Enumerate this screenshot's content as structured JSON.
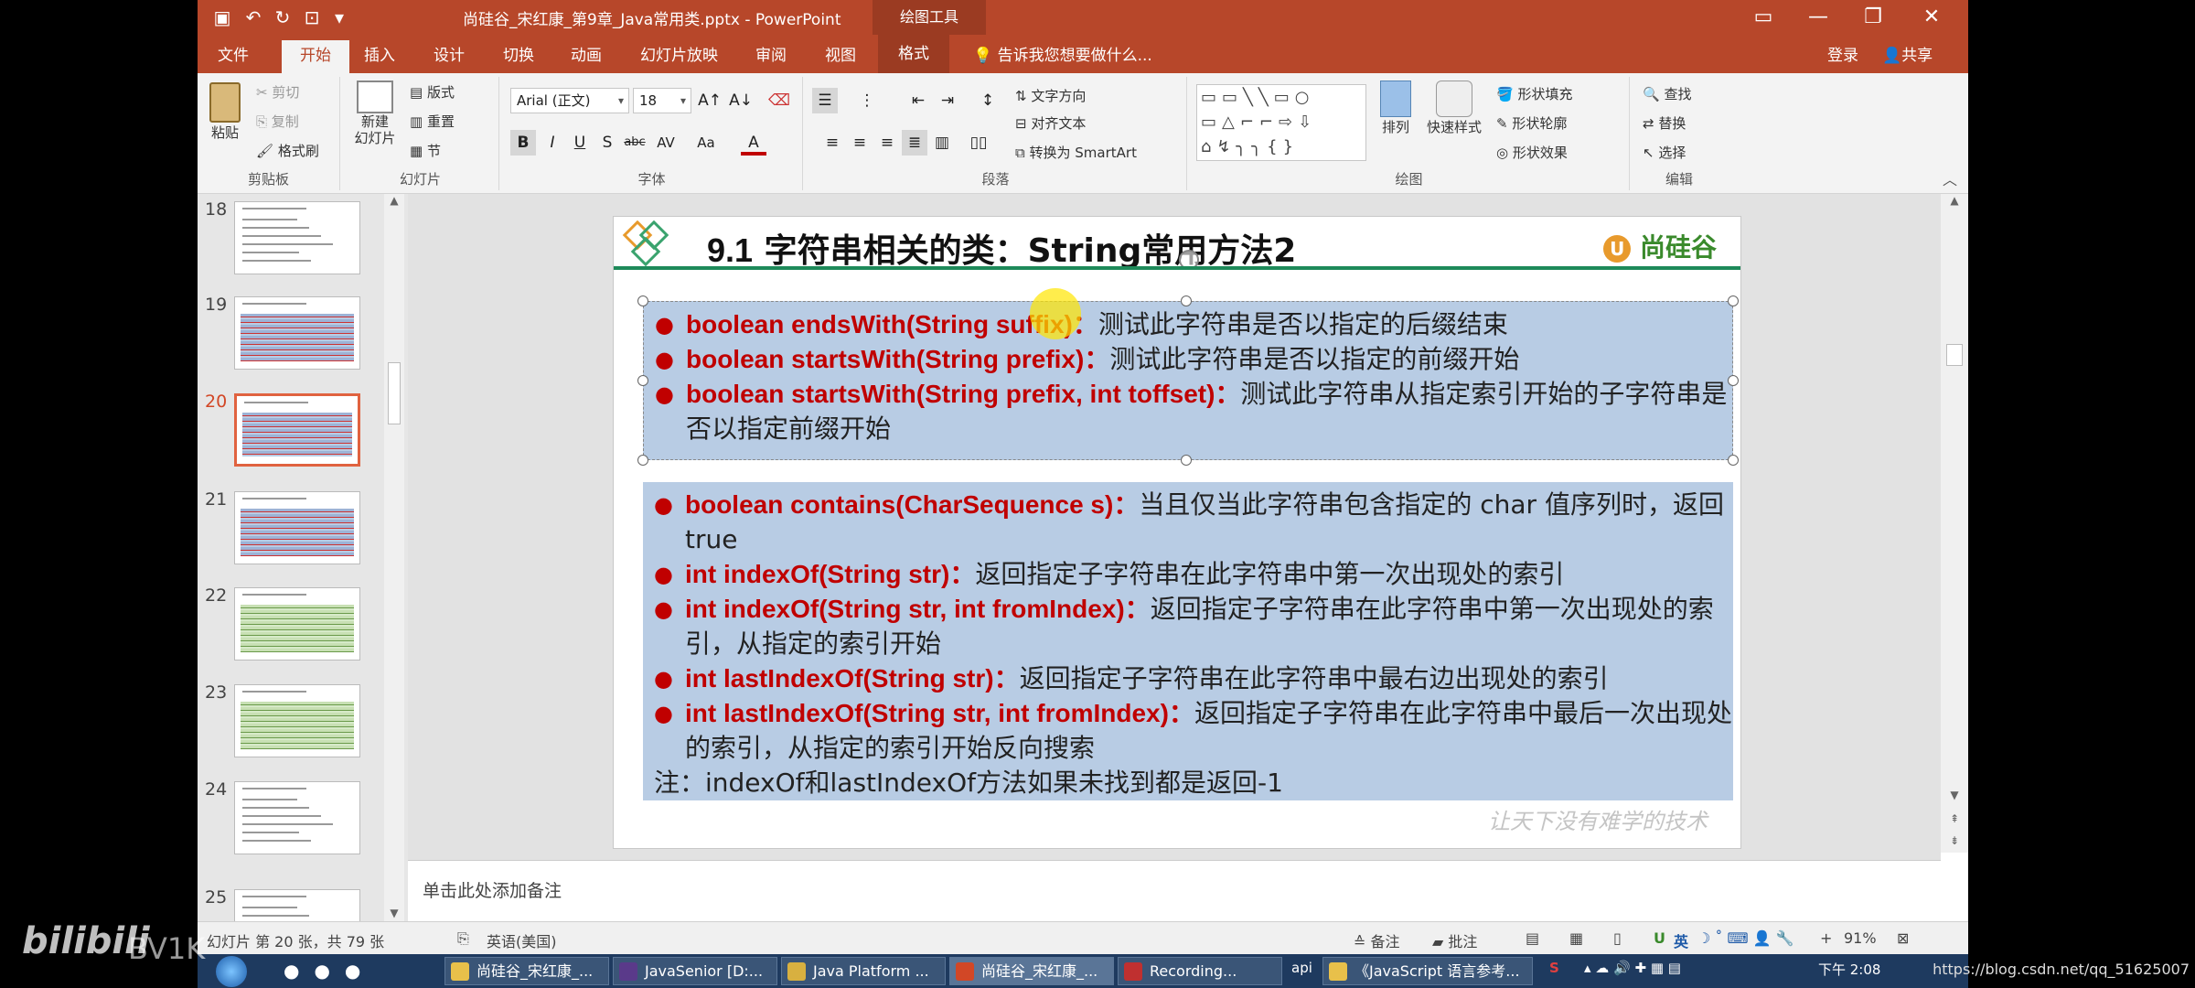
{
  "app": {
    "doc_title": "尚硅谷_宋红康_第9章_Java常用类.pptx - PowerPoint",
    "context_tools": "绘图工具",
    "login": "登录",
    "share": "共享"
  },
  "tabs": [
    "文件",
    "开始",
    "插入",
    "设计",
    "切换",
    "动画",
    "幻灯片放映",
    "审阅",
    "视图",
    "格式",
    "告诉我您想要做什么..."
  ],
  "ribbon": {
    "clipboard": {
      "paste": "粘贴",
      "cut": "剪切",
      "copy": "复制",
      "painter": "格式刷",
      "label": "剪贴板"
    },
    "slides": {
      "new": "新建\n幻灯片",
      "layout": "版式",
      "reset": "重置",
      "section": "节",
      "label": "幻灯片"
    },
    "font": {
      "name": "Arial (正文)",
      "size": "18",
      "label": "字体",
      "buttons": [
        "B",
        "I",
        "U",
        "S",
        "abc",
        "AV",
        "Aa",
        "A"
      ]
    },
    "paragraph": {
      "text_dir": "文字方向",
      "align_text": "对齐文本",
      "smartart": "转换为 SmartArt",
      "label": "段落"
    },
    "drawing": {
      "arrange": "排列",
      "quick_styles": "快速样式",
      "fill": "形状填充",
      "outline": "形状轮廓",
      "effects": "形状效果",
      "label": "绘图"
    },
    "editing": {
      "find": "查找",
      "replace": "替换",
      "select": "选择",
      "label": "编辑"
    }
  },
  "thumbnails": [
    {
      "num": "18",
      "current": false,
      "style": "plain"
    },
    {
      "num": "19",
      "current": false,
      "style": "blue"
    },
    {
      "num": "20",
      "current": true,
      "style": "blue"
    },
    {
      "num": "21",
      "current": false,
      "style": "blue"
    },
    {
      "num": "22",
      "current": false,
      "style": "green"
    },
    {
      "num": "23",
      "current": false,
      "style": "green"
    },
    {
      "num": "24",
      "current": false,
      "style": "plain"
    },
    {
      "num": "25",
      "current": false,
      "style": "plain"
    }
  ],
  "slide": {
    "number_prefix": "9.1",
    "title": "字符串相关的类：String常用方法2",
    "brand": "尚硅谷",
    "footer_motto": "让天下没有难学的技术",
    "box1": [
      {
        "sig": "boolean endsWith(String suffix)：",
        "desc": "测试此字符串是否以指定的后缀结束"
      },
      {
        "sig": "boolean startsWith(String prefix)：",
        "desc": "测试此字符串是否以指定的前缀开始"
      },
      {
        "sig": "boolean startsWith(String prefix, int toffset)：",
        "desc": "测试此字符串从指定索引开始的子字符串是否以指定前缀开始"
      }
    ],
    "box2": [
      {
        "sig": "boolean contains(CharSequence s)：",
        "desc": "当且仅当此字符串包含指定的 char 值序列时，返回 true"
      },
      {
        "sig": "int indexOf(String str)：",
        "desc": "返回指定子字符串在此字符串中第一次出现处的索引"
      },
      {
        "sig": "int indexOf(String str, int fromIndex)：",
        "desc": "返回指定子字符串在此字符串中第一次出现处的索引，从指定的索引开始"
      },
      {
        "sig": "int lastIndexOf(String str)：",
        "desc": "返回指定子字符串在此字符串中最右边出现处的索引"
      },
      {
        "sig": "int lastIndexOf(String str, int fromIndex)：",
        "desc": "返回指定子字符串在此字符串中最后一次出现处的索引，从指定的索引开始反向搜索"
      }
    ],
    "note": "注：indexOf和lastIndexOf方法如果未找到都是返回-1"
  },
  "notes_placeholder": "单击此处添加备注",
  "status": {
    "slide_info": "幻灯片 第 20 张，共 79 张",
    "language": "英语(美国)",
    "notes_btn": "备注",
    "comments_btn": "批注",
    "zoom": "91%"
  },
  "taskbar": {
    "items": [
      "尚硅谷_宋红康_...",
      "JavaSenior [D:...",
      "Java Platform ...",
      "尚硅谷_宋红康_...",
      "Recording...",
      "《JavaScript 语言参考..."
    ],
    "api": "api",
    "ime": "英",
    "clock": "下午 2:08"
  },
  "overlay": {
    "bili": "bilibili",
    "bv": "BV1K",
    "url": "https://blog.csdn.net/qq_51625007"
  },
  "colors": {
    "accent": "#b7472a",
    "slide_box": "#b8cce4",
    "sig_red": "#c00000",
    "green_rule": "#1e8a5a"
  }
}
